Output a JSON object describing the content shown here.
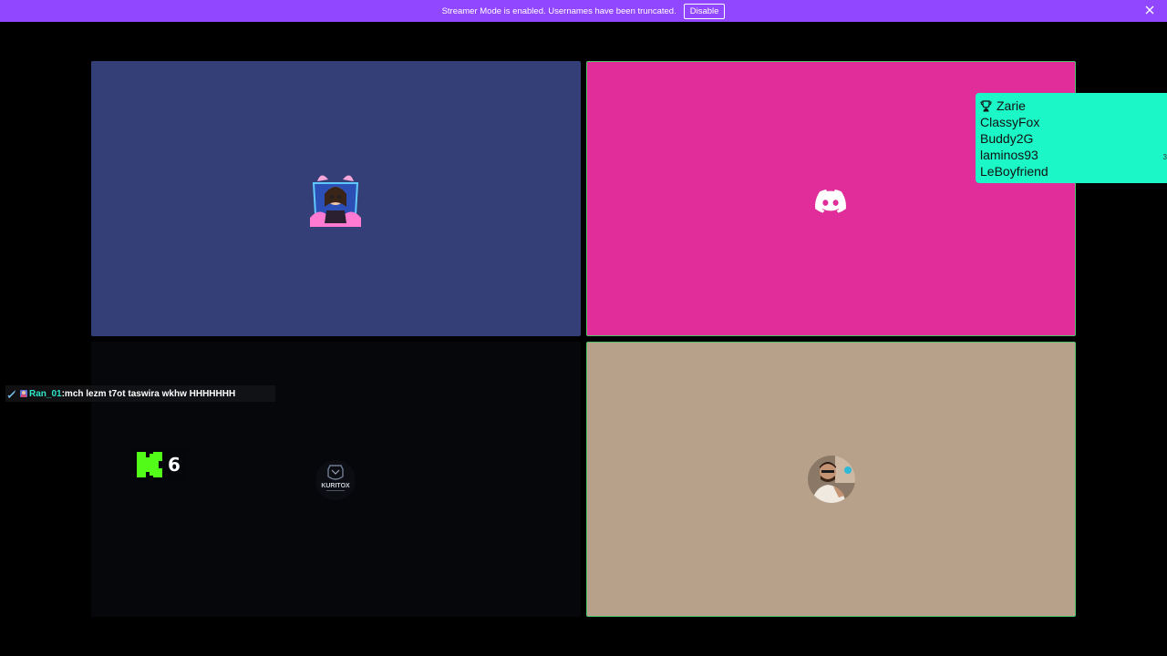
{
  "banner": {
    "message": "Streamer Mode is enabled. Usernames have been truncated.",
    "disable_label": "Disable",
    "background": "#9146ff"
  },
  "tiles": [
    {
      "id": "tile-1",
      "background": "#353f77",
      "content": "anime-avatar",
      "speaking": false
    },
    {
      "id": "tile-2",
      "background": "#e02d9a",
      "content": "discord-logo-icon",
      "speaking": true
    },
    {
      "id": "tile-3",
      "background": "#06070b",
      "content": "kuritox-logo",
      "speaking": false
    },
    {
      "id": "tile-4",
      "background": "#b8a18a",
      "content": "user-avatar",
      "speaking": true
    }
  ],
  "kuritox_label": "KURITOX",
  "leaderboard": {
    "background": "#1cf7c7",
    "icon": "trophy-icon",
    "entries": [
      "Zarie",
      "ClassyFox",
      "Buddy2G",
      "laminos93",
      "LeBoyfriend"
    ],
    "edge_mark": "3"
  },
  "chat": {
    "username": "Ran_01",
    "separator": ":",
    "message": " mch lezm t7ot taswira wkhw HHHHHHH",
    "username_color": "#2ee6c8"
  },
  "kick_widget": {
    "icon": "kick-logo-icon",
    "count": "6",
    "accent": "#53fc18"
  },
  "speaking_border_color": "#4fc26a"
}
